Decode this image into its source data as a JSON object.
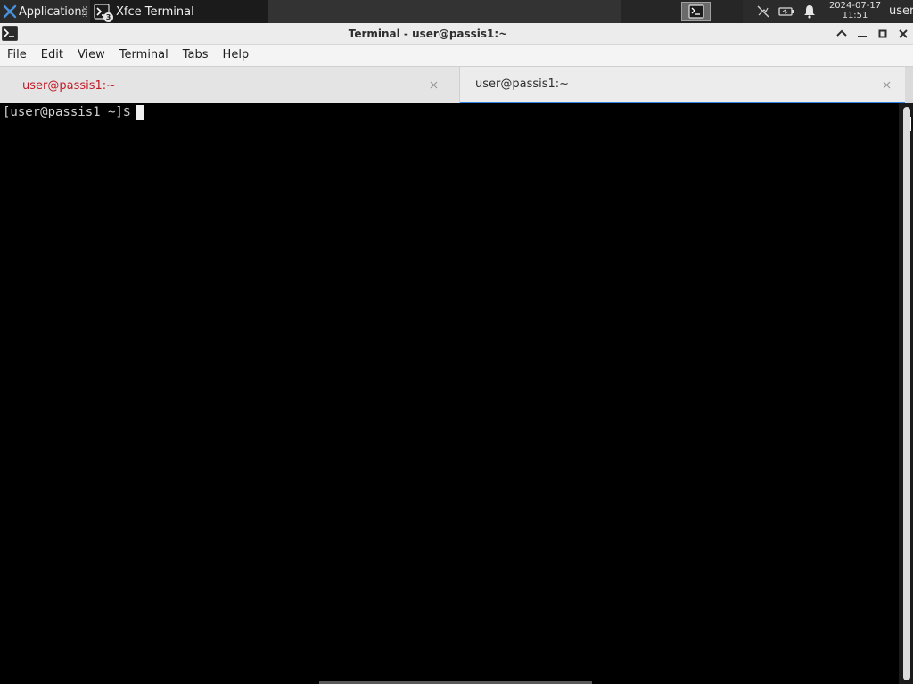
{
  "panel": {
    "applications_label": "Applications",
    "task": {
      "label": "Xfce Terminal",
      "badge": "3"
    },
    "clock": {
      "date": "2024-07-17",
      "time": "11:51"
    },
    "user": "user",
    "icons": {
      "menu": "xfce-mouse-icon",
      "network": "network-disconnected-icon",
      "battery": "battery-icon",
      "notifications": "bell-icon",
      "workspace": "terminal-icon"
    }
  },
  "window": {
    "title": "Terminal - user@passis1:~",
    "icon": "terminal-icon",
    "controls": [
      "shade-up-icon",
      "minimize-icon",
      "maximize-icon",
      "close-icon"
    ]
  },
  "menu": {
    "items": [
      "File",
      "Edit",
      "View",
      "Terminal",
      "Tabs",
      "Help"
    ]
  },
  "tabs": [
    {
      "label": "user@passis1:~",
      "active": false,
      "color": "#c01c28"
    },
    {
      "label": "user@passis1:~",
      "active": true,
      "color": "#2e2e2e"
    }
  ],
  "terminal": {
    "prompt": "[user@passis1 ~]$",
    "input": "",
    "background": "#000000",
    "foreground": "#d0d0d0"
  },
  "colors": {
    "panel_bg": "#2b2b2b",
    "accent": "#3584e4",
    "inactive_tab_text": "#c01c28"
  }
}
